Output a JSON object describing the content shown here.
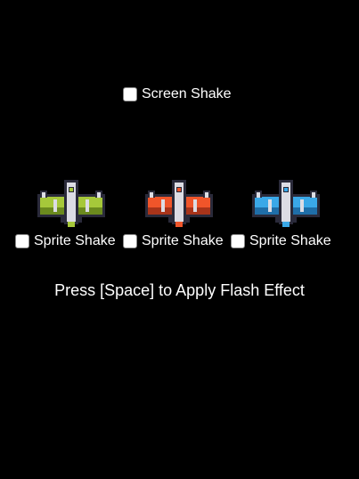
{
  "screen_shake": {
    "label": "Screen Shake",
    "checked": false
  },
  "sprites": [
    {
      "name": "green-ship",
      "shake_label": "Sprite Shake",
      "checked": false,
      "accent": "#a6c83a",
      "accent_dark": "#6b8a1e"
    },
    {
      "name": "orange-ship",
      "shake_label": "Sprite Shake",
      "checked": false,
      "accent": "#f0552a",
      "accent_dark": "#a8341a"
    },
    {
      "name": "blue-ship",
      "shake_label": "Sprite Shake",
      "checked": false,
      "accent": "#3aa8e8",
      "accent_dark": "#1f6ea8"
    }
  ],
  "instruction": "Press [Space] to Apply Flash Effect",
  "colors": {
    "background": "#000000",
    "text": "#ffffff",
    "hull": "#dcdce4",
    "outline": "#2a2a3a"
  }
}
